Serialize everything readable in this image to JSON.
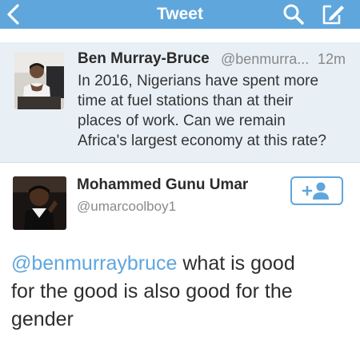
{
  "nav": {
    "title": "Tweet",
    "back_icon": "chevron-left-icon",
    "search_icon": "search-icon",
    "compose_icon": "compose-icon",
    "bar_color": "#5fa6dd"
  },
  "original_tweet": {
    "name": "Ben Murray-Bruce",
    "handle": "@benmurra...",
    "time": "12m",
    "text_lines": [
      "In 2016, Nigerians have spent more",
      "time at fuel stations than at their",
      "places of work. Can we remain",
      "Africa's largest economy at this rate?"
    ],
    "background_color": "#e8f0f6"
  },
  "reply": {
    "name": "Mohammed Gunu Umar",
    "handle": "@umarcoolboy1",
    "follow_icon": "add-user-icon",
    "mention": "@benmurraybruce",
    "text_line1_rest": " what is good",
    "text_line2": "for the good is also good for the",
    "text_line3": "gender",
    "mention_color": "#5fa6dd"
  }
}
